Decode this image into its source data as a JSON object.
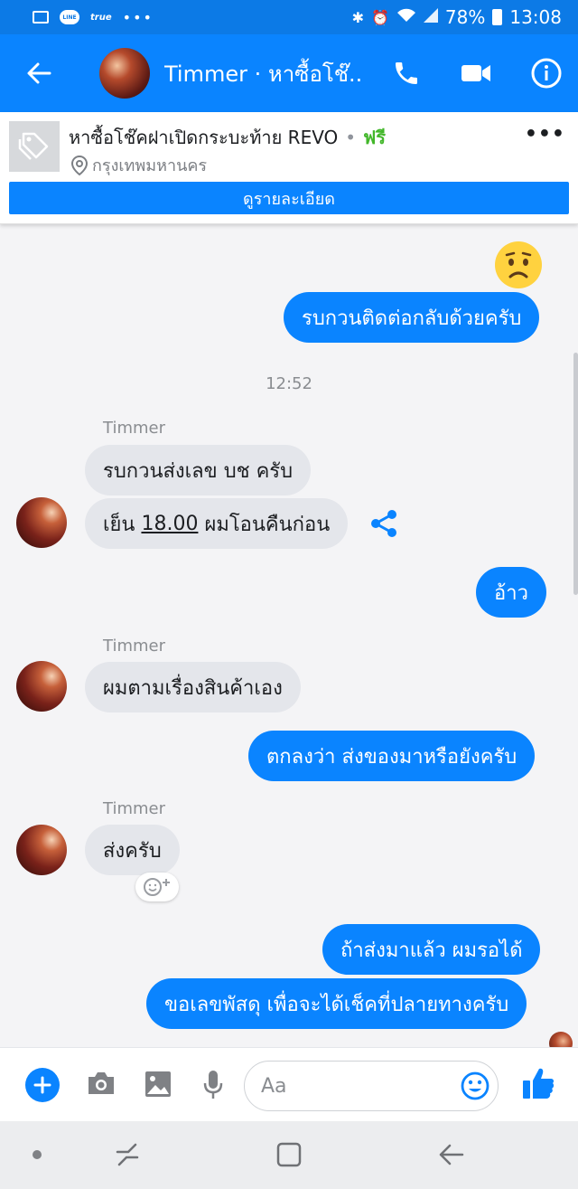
{
  "status_bar": {
    "line_label": "LINE",
    "carrier": "true",
    "dots": "•••",
    "battery": "78%",
    "time": "13:08"
  },
  "header": {
    "title": "Timmer · หาซื้อโช๊..."
  },
  "listing": {
    "title": "หาซื้อโช๊คฝาเปิดกระบะท้าย REVO",
    "price": "ฟรี",
    "location": "กรุงเทพมหานคร",
    "details_button": "ดูรายละเอียด"
  },
  "conversation": {
    "sender_name": "Timmer",
    "timestamp": "12:52",
    "msg_1": "รบกวนติดต่อกลับด้วยครับ",
    "msg_2": "รบกวนส่งเลข บช ครับ",
    "msg_3_pre": "เย็น ",
    "msg_3_time": "18.00",
    "msg_3_post": " ผมโอนคืนก่อน",
    "msg_4": "อ้าว",
    "msg_5": "ผมตามเรื่องสินค้าเอง",
    "msg_6": "ตกลงว่า ส่งของมาหรือยังครับ",
    "msg_7": "ส่งครับ",
    "msg_8": "ถ้าส่งมาแล้ว ผมรอได้",
    "msg_9": "ขอเลขพัสดุ เพื่อจะได้เช็คที่ปลายทางครับ"
  },
  "composer": {
    "placeholder": "Aa"
  },
  "colors": {
    "accent": "#0a84ff",
    "incoming_bubble": "#e4e6eb",
    "free_price": "#42b72a"
  },
  "icons": [
    "back-arrow-icon",
    "phone-icon",
    "video-icon",
    "info-icon",
    "tag-icon",
    "location-pin-icon",
    "more-icon",
    "share-icon",
    "add-reaction-icon",
    "plus-icon",
    "camera-icon",
    "gallery-icon",
    "microphone-icon",
    "emoji-icon",
    "like-icon"
  ]
}
